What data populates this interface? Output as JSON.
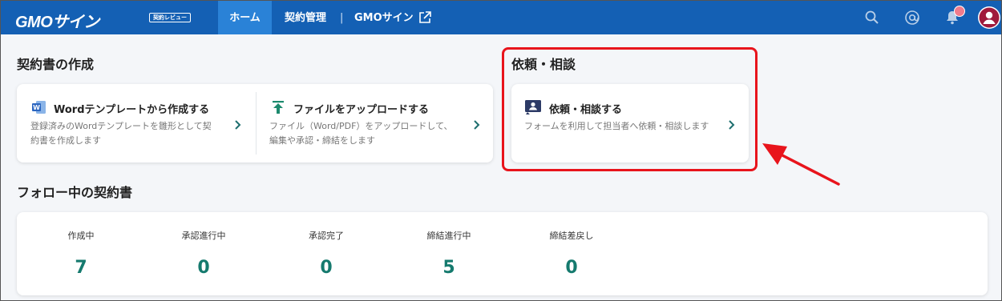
{
  "header": {
    "logo": "GMOサイン",
    "logo_badge": "契約レビュー",
    "nav_home": "ホーム",
    "nav_contracts": "契約管理",
    "nav_separator": "|",
    "nav_gmo": "GMOサイン",
    "icons": [
      "search-icon",
      "at-icon",
      "bell-icon",
      "user-icon"
    ],
    "brand_color": "#1460b4",
    "active_color": "#2a82d7",
    "notification_color": "#f07b8c"
  },
  "create_section": {
    "title": "契約書の作成",
    "items": [
      {
        "title": "Wordテンプレートから作成する",
        "desc_line1": "登録済みのWordテンプレートを雛形として契",
        "desc_line2": "約書を作成します",
        "icon": "word-icon"
      },
      {
        "title": "ファイルをアップロードする",
        "desc_line1": "ファイル（Word/PDF）をアップロードして、",
        "desc_line2": "編集や承認・締結をします",
        "icon": "upload-icon"
      }
    ]
  },
  "request_section": {
    "title": "依頼・相談",
    "item": {
      "title": "依頼・相談する",
      "desc": "フォームを利用して担当者へ依頼・相談します",
      "icon": "contact-icon"
    },
    "highlight_color": "#e8141c"
  },
  "follow_section": {
    "title": "フォロー中の契約書",
    "stats": [
      {
        "label": "作成中",
        "value": "7"
      },
      {
        "label": "承認進行中",
        "value": "0"
      },
      {
        "label": "承認完了",
        "value": "0"
      },
      {
        "label": "締結進行中",
        "value": "5"
      },
      {
        "label": "締結差戻し",
        "value": "0"
      }
    ],
    "value_color": "#157a6e"
  }
}
